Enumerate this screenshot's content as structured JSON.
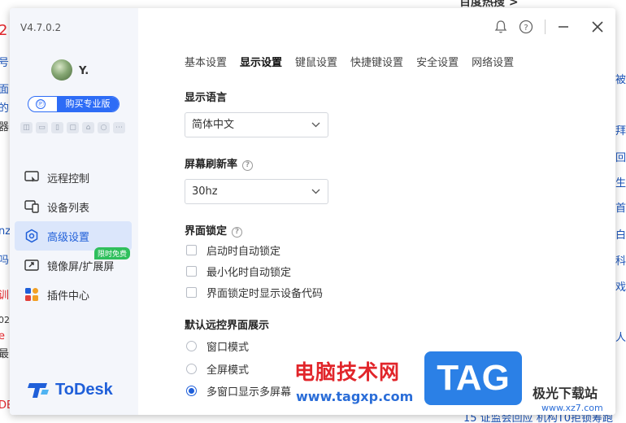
{
  "background": {
    "top_text": "百度热搜 >",
    "left_fragments": [
      "2",
      "号",
      "面",
      "的",
      "器",
      "nz",
      "吗",
      "训",
      "02",
      "e",
      "最",
      "DE"
    ],
    "right_fragments": [
      "被",
      "拜",
      "回",
      "生",
      "首",
      "白",
      "科",
      "戏",
      "人"
    ],
    "bottom_text": "15  证监会回应 机构T0拒锁筹跑"
  },
  "app": {
    "version": "V4.7.0.2",
    "user": {
      "name": "Y."
    },
    "pro_button": {
      "icon": "Ⓟ",
      "label": "购买专业版"
    },
    "device_icons": [
      "gamepad-icon",
      "monitor-icon",
      "tablet-icon",
      "tv-icon",
      "android-icon",
      "linux-icon",
      "more-icon"
    ],
    "nav": [
      {
        "label": "远程控制",
        "icon": "remote-control-icon",
        "active": false
      },
      {
        "label": "设备列表",
        "icon": "device-list-icon",
        "active": false
      },
      {
        "label": "高级设置",
        "icon": "advanced-settings-icon",
        "active": true
      },
      {
        "label": "镜像屏/扩展屏",
        "icon": "mirror-screen-icon",
        "active": false,
        "badge": "限时免费"
      },
      {
        "label": "插件中心",
        "icon": "plugin-center-icon",
        "active": false
      }
    ],
    "brand": "ToDesk",
    "tabs": [
      "基本设置",
      "显示设置",
      "键鼠设置",
      "快捷键设置",
      "安全设置",
      "网络设置"
    ],
    "active_tab": "显示设置",
    "settings": {
      "language": {
        "title": "显示语言",
        "value": "简体中文"
      },
      "refresh": {
        "title": "屏幕刷新率",
        "value": "30hz"
      },
      "lock": {
        "title": "界面锁定",
        "options": [
          "启动时自动锁定",
          "最小化时自动锁定",
          "界面锁定时显示设备代码"
        ]
      },
      "remote_view": {
        "title": "默认远控界面展示",
        "options": [
          "窗口模式",
          "全屏模式",
          "多窗口显示多屏幕"
        ],
        "selected_index": 2
      }
    },
    "accent_color": "#1f5fd9"
  },
  "watermark": {
    "text": "电脑技术网",
    "url": "www.tagxp.com",
    "tag": "TAG",
    "site": "极光下载站",
    "site_url": "www.xz7.com"
  }
}
